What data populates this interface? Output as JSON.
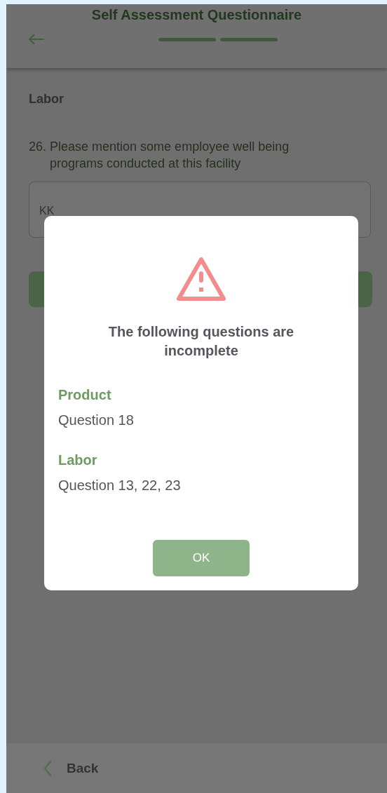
{
  "header": {
    "title": "Self Assessment Questionnaire",
    "steps": [
      {
        "done": true
      },
      {
        "done": true
      }
    ]
  },
  "section": "Labor",
  "question": {
    "number": "26.",
    "text": "Please mention some employee well being programs conducted at this facility",
    "answer": "KK"
  },
  "dialog": {
    "title": "The following questions are incomplete",
    "groups": [
      {
        "category": "Product",
        "questions": "Question 18"
      },
      {
        "category": "Labor",
        "questions": "Question 13, 22, 23"
      }
    ],
    "button": "OK"
  },
  "bottom_bar": {
    "back": "Back"
  }
}
